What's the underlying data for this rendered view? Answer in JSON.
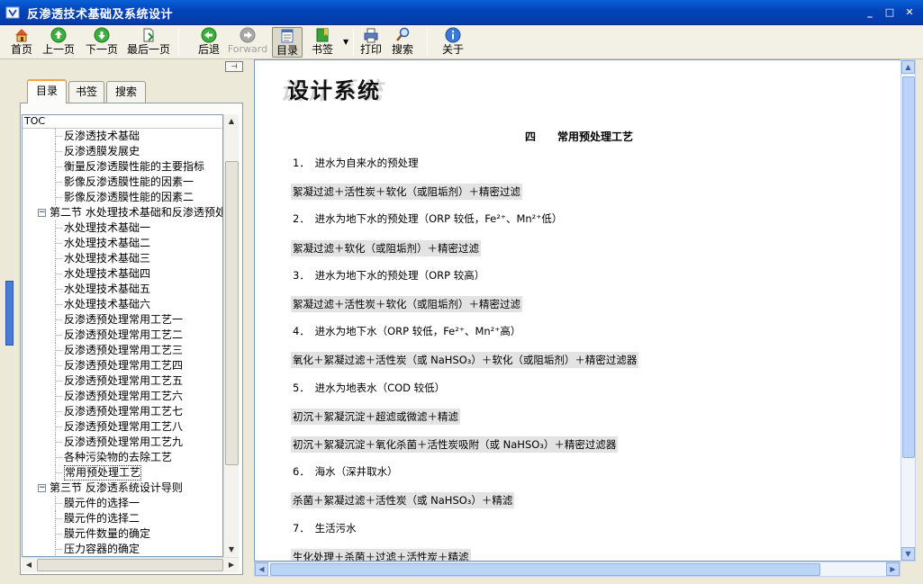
{
  "window": {
    "title": "反渗透技术基础及系统设计"
  },
  "toolbar": {
    "home": "首页",
    "prev": "上一页",
    "next": "下一页",
    "last": "最后一页",
    "back": "后退",
    "forward": "Forward",
    "toc": "目录",
    "bookmark": "书签",
    "print": "打印",
    "search": "搜索",
    "about": "关于"
  },
  "tabs": {
    "toc": "目录",
    "bookmark": "书签",
    "search": "搜索"
  },
  "tree": {
    "header": "TOC",
    "items": [
      {
        "label": "反渗透技术基础",
        "level": 2
      },
      {
        "label": "反渗透膜发展史",
        "level": 2
      },
      {
        "label": "衡量反渗透膜性能的主要指标",
        "level": 2
      },
      {
        "label": "影像反渗透膜性能的因素一",
        "level": 2
      },
      {
        "label": "影像反渗透膜性能的因素二",
        "level": 2
      },
      {
        "label": "第二节 水处理技术基础和反渗透预处",
        "level": 1,
        "expanded": true
      },
      {
        "label": "水处理技术基础一",
        "level": 2
      },
      {
        "label": "水处理技术基础二",
        "level": 2
      },
      {
        "label": "水处理技术基础三",
        "level": 2
      },
      {
        "label": "水处理技术基础四",
        "level": 2
      },
      {
        "label": "水处理技术基础五",
        "level": 2
      },
      {
        "label": "水处理技术基础六",
        "level": 2
      },
      {
        "label": "反渗透预处理常用工艺一",
        "level": 2
      },
      {
        "label": "反渗透预处理常用工艺二",
        "level": 2
      },
      {
        "label": "反渗透预处理常用工艺三",
        "level": 2
      },
      {
        "label": "反渗透预处理常用工艺四",
        "level": 2
      },
      {
        "label": "反渗透预处理常用工艺五",
        "level": 2
      },
      {
        "label": "反渗透预处理常用工艺六",
        "level": 2
      },
      {
        "label": "反渗透预处理常用工艺七",
        "level": 2
      },
      {
        "label": "反渗透预处理常用工艺八",
        "level": 2
      },
      {
        "label": "反渗透预处理常用工艺九",
        "level": 2
      },
      {
        "label": "各种污染物的去除工艺",
        "level": 2
      },
      {
        "label": "常用预处理工艺",
        "level": 2,
        "selected": true
      },
      {
        "label": "第三节 反渗透系统设计导则",
        "level": 1,
        "expanded": true
      },
      {
        "label": "膜元件的选择一",
        "level": 2
      },
      {
        "label": "膜元件的选择二",
        "level": 2
      },
      {
        "label": "膜元件数量的确定",
        "level": 2
      },
      {
        "label": "压力容器的确定",
        "level": 2
      }
    ]
  },
  "content": {
    "banner": "设计系统",
    "banner_shadow": "设计系统",
    "section_title": "四　　常用预处理工艺",
    "lines": [
      {
        "text": "1．　进水为自来水的预处理",
        "highlight": false
      },
      {
        "text": "絮凝过滤＋活性炭＋软化（或阻垢剂）＋精密过滤",
        "highlight": true
      },
      {
        "text": "2．　进水为地下水的预处理（ORP 较低，Fe²⁺、Mn²⁺低）",
        "highlight": false
      },
      {
        "text": "絮凝过滤＋软化（或阻垢剂）＋精密过滤",
        "highlight": true
      },
      {
        "text": "3．　进水为地下水的预处理（ORP 较高）",
        "highlight": false
      },
      {
        "text": "絮凝过滤＋活性炭＋软化（或阻垢剂）＋精密过滤",
        "highlight": true
      },
      {
        "text": "4．　进水为地下水（ORP 较低，Fe²⁺、Mn²⁺高）",
        "highlight": false
      },
      {
        "text": "氧化＋絮凝过滤＋活性炭（或 NaHSO₃）＋软化（或阻垢剂）＋精密过滤器",
        "highlight": true
      },
      {
        "text": "5．　进水为地表水（COD 较低）",
        "highlight": false
      },
      {
        "text": "初沉＋絮凝沉淀＋超滤或微滤＋精滤",
        "highlight": true
      },
      {
        "text": "初沉＋絮凝沉淀＋氧化杀菌＋活性炭吸附（或 NaHSO₃）＋精密过滤器",
        "highlight": true
      },
      {
        "text": "6．　海水（深井取水）",
        "highlight": false
      },
      {
        "text": "杀菌＋絮凝过滤＋活性炭（或 NaHSO₃）＋精滤",
        "highlight": true
      },
      {
        "text": "7．　生活污水",
        "highlight": false
      },
      {
        "text": "生化处理＋杀菌＋过滤＋活性炭＋精滤",
        "highlight": true
      }
    ]
  }
}
